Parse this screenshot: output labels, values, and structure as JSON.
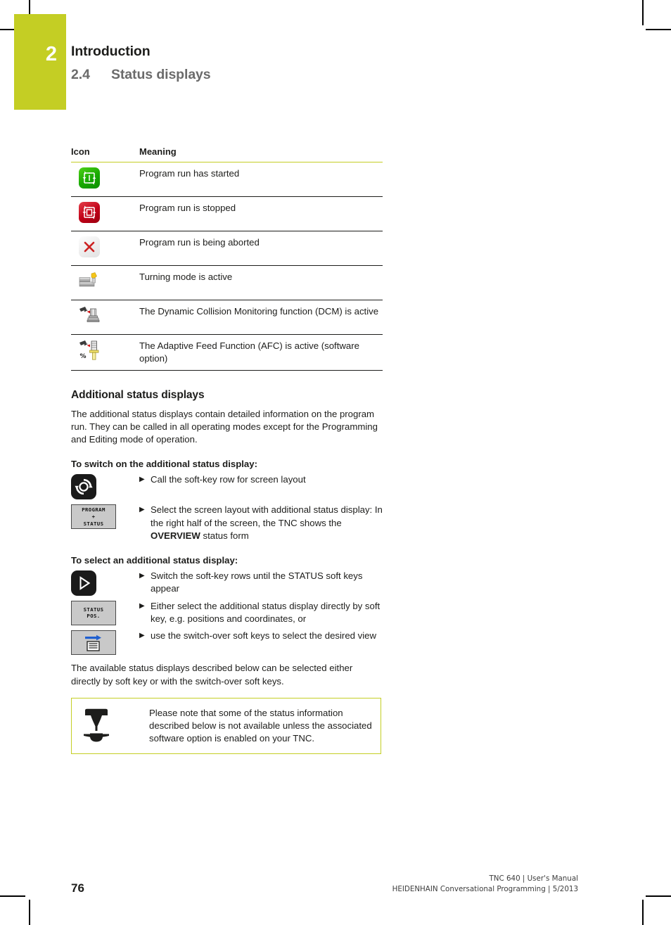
{
  "chapter": {
    "number": "2",
    "title": "Introduction",
    "section_number": "2.4",
    "section_title": "Status displays"
  },
  "icon_table": {
    "headers": {
      "icon": "Icon",
      "meaning": "Meaning"
    },
    "rows": [
      {
        "icon_name": "program-run-started-icon",
        "meaning": "Program run has started"
      },
      {
        "icon_name": "program-run-stopped-icon",
        "meaning": "Program run is stopped"
      },
      {
        "icon_name": "program-run-aborted-icon",
        "meaning": "Program run is being aborted"
      },
      {
        "icon_name": "turning-mode-icon",
        "meaning": "Turning mode is active"
      },
      {
        "icon_name": "dynamic-collision-monitoring-icon",
        "meaning": "The Dynamic Collision Monitoring function (DCM) is active"
      },
      {
        "icon_name": "adaptive-feed-control-icon",
        "meaning": "The Adaptive Feed Function (AFC) is active (software option)"
      }
    ]
  },
  "additional_status": {
    "heading": "Additional status displays",
    "intro": "The additional status displays contain detailed information on the program run. They can be called in all operating modes except for the Programming and Editing mode of operation.",
    "switch_on_heading": "To switch on the additional status display:",
    "switch_on_steps": [
      {
        "key_type": "hardware",
        "key_icon": "screen-layout-key-icon",
        "text_before": "Call the soft-key row for screen layout",
        "text_bold": "",
        "text_after": ""
      },
      {
        "key_type": "soft",
        "key_icon": "program-plus-status-softkey",
        "key_label_line1": "PROGRAM",
        "key_label_line2": "+",
        "key_label_line3": "STATUS",
        "text_before": "Select the screen layout with additional status display: In the right half of the screen, the TNC shows the ",
        "text_bold": "OVERVIEW",
        "text_after": " status form"
      }
    ],
    "select_heading": "To select an additional status display:",
    "select_steps": [
      {
        "key_type": "hardware",
        "key_icon": "softkey-row-right-arrow-key-icon",
        "text_before": "Switch the soft-key rows until the STATUS soft keys appear",
        "text_bold": "",
        "text_after": ""
      },
      {
        "key_type": "soft",
        "key_icon": "status-pos-softkey",
        "key_label_line1": "STATUS",
        "key_label_line2": "POS.",
        "key_label_line3": "",
        "text_before": "Either select the additional status display directly by soft key, e.g. positions and coordinates, or",
        "text_bold": "",
        "text_after": ""
      },
      {
        "key_type": "soft-icon",
        "key_icon": "switch-over-softkey",
        "key_label_line1": "",
        "key_label_line2": "",
        "key_label_line3": "",
        "text_before": "use the switch-over soft keys to select the desired view",
        "text_bold": "",
        "text_after": ""
      }
    ],
    "closing": "The available status displays described below can be selected either directly by soft key or with the switch-over soft keys."
  },
  "note": {
    "icon_name": "machine-tool-note-icon",
    "text": "Please note that some of the status information described below is not available unless the associated software option is enabled on your TNC."
  },
  "footer": {
    "page_number": "76",
    "line1": "TNC 640 | User's Manual",
    "line2": "HEIDENHAIN Conversational Programming | 5/2013"
  },
  "colors": {
    "accent_green": "#c4ce24",
    "status_green": "#17a800",
    "status_red": "#c00017",
    "abort_red": "#cc2222",
    "softkey_blue": "#1f5fd0",
    "turning_yellow": "#f5c518"
  }
}
